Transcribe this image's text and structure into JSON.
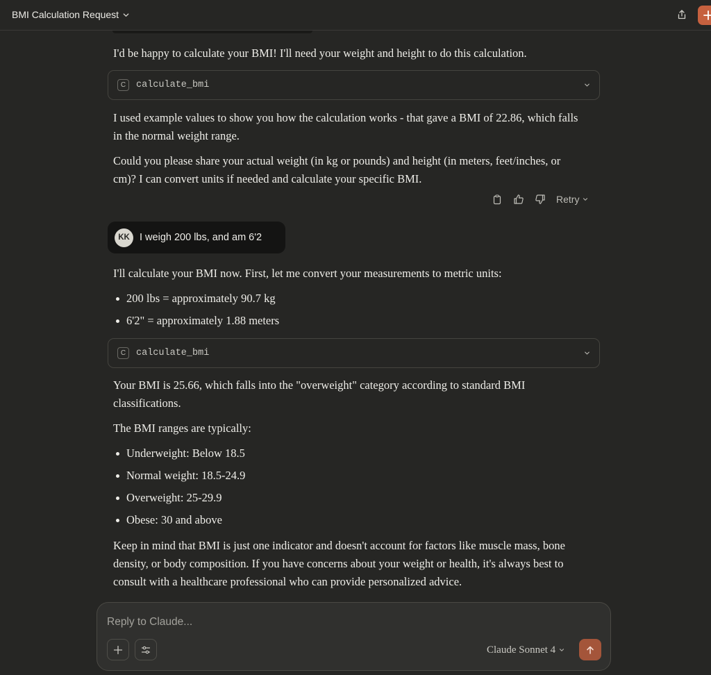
{
  "header": {
    "title": "BMI Calculation Request",
    "icons": {
      "title_chevron": "chevron-down-icon",
      "share": "share-icon",
      "new_chat": "plus-icon"
    }
  },
  "messages": {
    "assistant_1": {
      "intro": "I'd be happy to calculate your BMI! I'll need your weight and height to do this calculation.",
      "tool": {
        "badge": "C",
        "name": "calculate_bmi"
      },
      "para1": "I used example values to show you how the calculation works - that gave a BMI of 22.86, which falls in the normal weight range.",
      "para2": "Could you please share your actual weight (in kg or pounds) and height (in meters, feet/inches, or cm)? I can convert units if needed and calculate your specific BMI.",
      "actions": {
        "copy_icon": "copy-icon",
        "thumbs_up_icon": "thumbs-up-icon",
        "thumbs_down_icon": "thumbs-down-icon",
        "retry_label": "Retry"
      }
    },
    "user_1": {
      "initials": "KK",
      "text": "I weigh 200 lbs, and am 6'2"
    },
    "assistant_2": {
      "intro": "I'll calculate your BMI now. First, let me convert your measurements to metric units:",
      "conversions": [
        "200 lbs = approximately 90.7 kg",
        "6'2\" = approximately 1.88 meters"
      ],
      "tool": {
        "badge": "C",
        "name": "calculate_bmi"
      },
      "result": "Your BMI is 25.66, which falls into the \"overweight\" category according to standard BMI classifications.",
      "ranges_intro": "The BMI ranges are typically:",
      "ranges": [
        "Underweight: Below 18.5",
        "Normal weight: 18.5-24.9",
        "Overweight: 25-29.9",
        "Obese: 30 and above"
      ],
      "closing": "Keep in mind that BMI is just one indicator and doesn't account for factors like muscle mass, bone density, or body composition. If you have concerns about your weight or health, it's always best to consult with a healthcare professional who can provide personalized advice."
    }
  },
  "composer": {
    "placeholder": "Reply to Claude...",
    "value": "",
    "model": "Claude Sonnet 4",
    "icons": {
      "add": "plus-icon",
      "tools": "sliders-icon",
      "send": "arrow-up-icon",
      "model_chevron": "chevron-down-icon"
    }
  },
  "colors": {
    "background": "#262624",
    "accent": "#c6613f",
    "send_button": "#a4553a",
    "user_bubble": "#141413"
  }
}
